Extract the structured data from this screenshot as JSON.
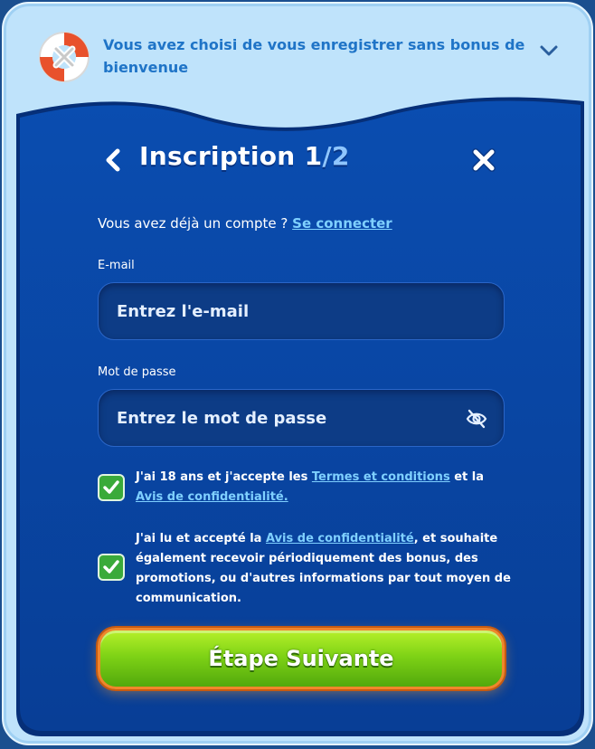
{
  "banner": {
    "text": "Vous avez choisi de vous enregistrer sans bonus de bienvenue"
  },
  "header": {
    "title": "Inscription 1",
    "step_suffix": "/2"
  },
  "login_prompt": {
    "text": "Vous avez déjà un compte ? ",
    "link": "Se connecter"
  },
  "email": {
    "label": "E-mail",
    "placeholder": "Entrez l'e-mail",
    "value": ""
  },
  "password": {
    "label": "Mot de passe",
    "placeholder": "Entrez le mot de passe",
    "value": ""
  },
  "consent_terms": {
    "checked": true,
    "text_1": "J'ai 18 ans et j'accepte les ",
    "link_1": "Termes et conditions",
    "text_2": " et la ",
    "link_2": "Avis de confidentialité."
  },
  "consent_marketing": {
    "checked": true,
    "text_1": "J'ai lu et accepté la ",
    "link_1": "Avis de confidentialité",
    "text_2": ", et souhaite également recevoir périodiquement des bonus, des promotions, ou d'autres informations par tout moyen de communication."
  },
  "next_button": {
    "label": "Étape Suivante"
  },
  "colors": {
    "panel": "#0b4aa6",
    "link": "#7fd0ff",
    "button_green": "#7fd316",
    "button_border": "#f0862b"
  }
}
